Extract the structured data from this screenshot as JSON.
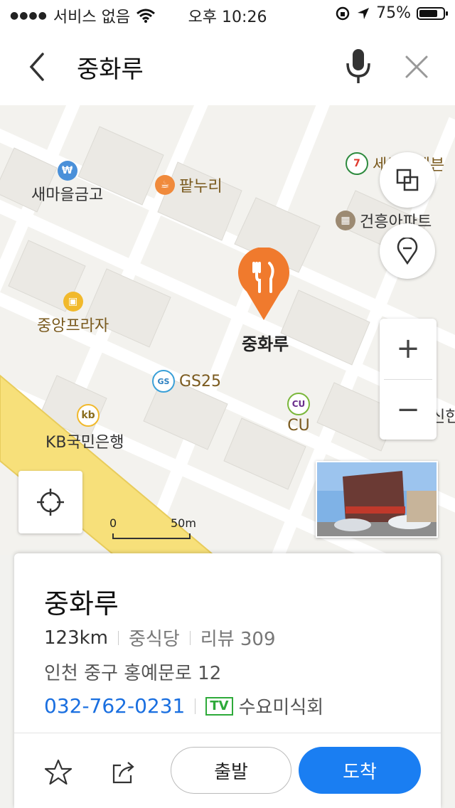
{
  "status_bar": {
    "carrier": "서비스 없음",
    "time": "오후 10:26",
    "battery": "75%",
    "icons": [
      "signal-dots",
      "wifi-icon",
      "rotation-lock-icon",
      "location-arrow-icon",
      "battery-icon"
    ]
  },
  "search": {
    "query": "중화루",
    "icons": [
      "back-icon",
      "microphone-icon",
      "close-icon"
    ]
  },
  "map": {
    "pois": [
      {
        "label": "새마을금고",
        "icon": "bank-won-icon"
      },
      {
        "label": "팥누리",
        "icon": "cafe-icon"
      },
      {
        "label": "세븐일레븐",
        "icon": "seven-eleven-icon"
      },
      {
        "label": "건흥아파트",
        "icon": "apartment-icon"
      },
      {
        "label": "중앙프라자",
        "icon": "shopping-icon"
      },
      {
        "label": "GS25",
        "icon": "gs25-icon"
      },
      {
        "label": "CU",
        "icon": "cu-icon"
      },
      {
        "label": "KB국민은행",
        "icon": "kb-bank-icon"
      },
      {
        "label": "신한",
        "icon": "bank-icon"
      }
    ],
    "selected_marker": {
      "label": "중화루",
      "icon": "restaurant-icon"
    },
    "scale": {
      "start": "0",
      "end": "50m"
    },
    "controls": [
      "layers-icon",
      "location-pin-icon",
      "zoom-in-icon",
      "zoom-out-icon",
      "my-location-icon",
      "roadview-thumbnail"
    ],
    "zoom_in": "+",
    "zoom_out": "−",
    "colors": {
      "road": "#ffffff",
      "block": "#ebe9e4",
      "main_road": "#f7e07a",
      "marker": "#f07a2d"
    }
  },
  "place": {
    "name": "중화루",
    "distance": "123km",
    "category": "중식당",
    "review": "리뷰 309",
    "address": "인천 중구 홍예문로 12",
    "phone": "032-762-0231",
    "tv_badge": "TV",
    "tv_show": "수요미식회",
    "depart_label": "출발",
    "arrive_label": "도착"
  }
}
